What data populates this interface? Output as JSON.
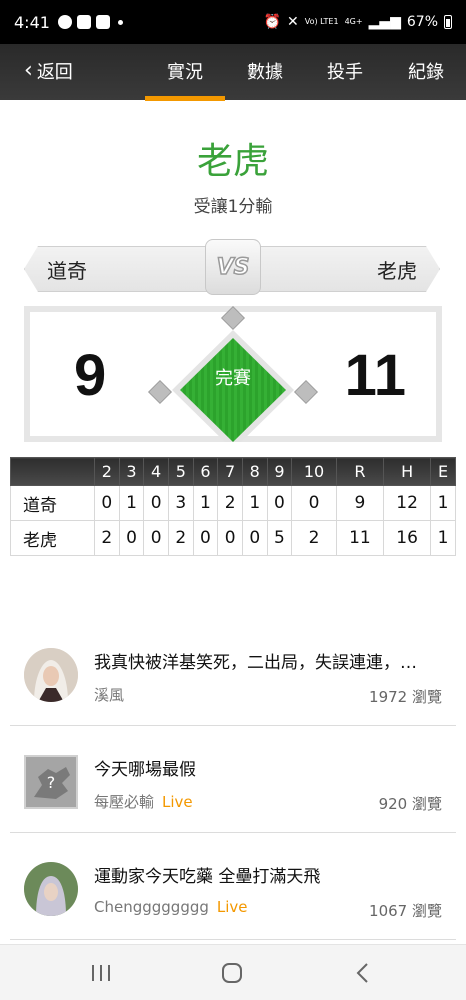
{
  "status": {
    "time": "4:41",
    "battery": "67%",
    "net": "4G+",
    "volte": "Vo) LTE1"
  },
  "nav": {
    "back": "返回",
    "tabs": [
      "實況",
      "數據",
      "投手",
      "紀錄"
    ],
    "active_tab": 0
  },
  "header": {
    "team": "老虎",
    "subtitle": "受讓1分輸"
  },
  "matchup": {
    "left_team": "道奇",
    "right_team": "老虎",
    "vs": "VS",
    "left_score": "9",
    "right_score": "11",
    "status": "完賽"
  },
  "linescore": {
    "columns": [
      "2",
      "3",
      "4",
      "5",
      "6",
      "7",
      "8",
      "9",
      "10",
      "R",
      "H",
      "E"
    ],
    "rows": [
      {
        "team": "道奇",
        "values": [
          "0",
          "1",
          "0",
          "3",
          "1",
          "2",
          "1",
          "0",
          "0",
          "9",
          "12",
          "1"
        ]
      },
      {
        "team": "老虎",
        "values": [
          "2",
          "0",
          "0",
          "2",
          "0",
          "0",
          "0",
          "5",
          "2",
          "11",
          "16",
          "1"
        ]
      }
    ]
  },
  "posts": [
    {
      "title": "我真快被洋基笑死，二出局，失誤連連，…",
      "author": "溪風",
      "live": "",
      "views": "1972 瀏覽"
    },
    {
      "title": "今天哪場最假",
      "author": "每壓必輸",
      "live": "Live",
      "views": "920 瀏覽"
    },
    {
      "title": "運動家今天吃藥  全壘打滿天飛",
      "author": "Chengggggggg",
      "live": "Live",
      "views": "1067 瀏覽"
    }
  ],
  "colors": {
    "accent": "#f39800",
    "team_green": "#3aa23a",
    "field_green": "#2ca32c"
  }
}
